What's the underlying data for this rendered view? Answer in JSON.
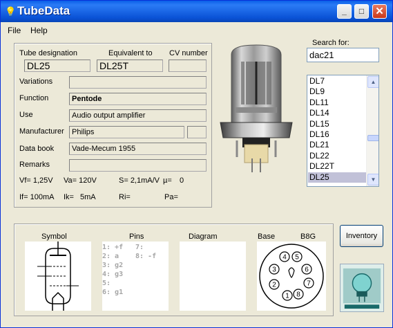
{
  "window": {
    "title": "TubeData"
  },
  "menu": {
    "file": "File",
    "help": "Help"
  },
  "tube": {
    "designation_label": "Tube designation",
    "designation": "DL25",
    "equivalent_label": "Equivalent to",
    "equivalent": "DL25T",
    "cv_label": "CV number",
    "cv": "",
    "variations_label": "Variations",
    "variations": "",
    "function_label": "Function",
    "function": "Pentode",
    "use_label": "Use",
    "use": "Audio output amplifier",
    "manufacturer_label": "Manufacturer",
    "manufacturer": "Philips",
    "manufacturer_extra": "",
    "databook_label": "Data book",
    "databook": "Vade-Mecum 1955",
    "remarks_label": "Remarks",
    "remarks": "",
    "vf": "Vf= 1,25V",
    "va": "Va= 120V",
    "s": "S= 2,1mA/V",
    "mu": "µ=",
    "mu_value": "0",
    "if": "If= 100mA",
    "ik": "Ik=",
    "ik_value": "5mA",
    "ri": "Ri=",
    "pa": "Pa="
  },
  "search": {
    "label": "Search for:",
    "value": "dac21"
  },
  "tube_list": {
    "items": [
      "DL7",
      "DL9",
      "DL11",
      "DL14",
      "DL15",
      "DL16",
      "DL21",
      "DL22",
      "DL22T",
      "DL25"
    ],
    "selected": "DL25"
  },
  "bottom": {
    "symbol_label": "Symbol",
    "pins_label": "Pins",
    "diagram_label": "Diagram",
    "base_label": "Base",
    "base_type": "B8G",
    "pins": {
      "p1": "1: +f",
      "p2": "2: a",
      "p3": "3: g2",
      "p4": "4: g3",
      "p5": "5:",
      "p6": "6: g1",
      "p7": "7:",
      "p8": "8: -f"
    },
    "base_pin_numbers": [
      "1",
      "2",
      "3",
      "4",
      "5",
      "6",
      "7",
      "8"
    ]
  },
  "inventory_label": "Inventory",
  "icons": {
    "app": "bulb-icon",
    "minimize": "minimize-icon",
    "maximize": "maximize-icon",
    "close": "close-icon",
    "scroll_up": "scroll-up-icon",
    "scroll_down": "scroll-down-icon"
  },
  "colors": {
    "titlebar": "#0a5fe8",
    "window_bg": "#ece9d8",
    "list_selected": "#c1c1d8"
  }
}
